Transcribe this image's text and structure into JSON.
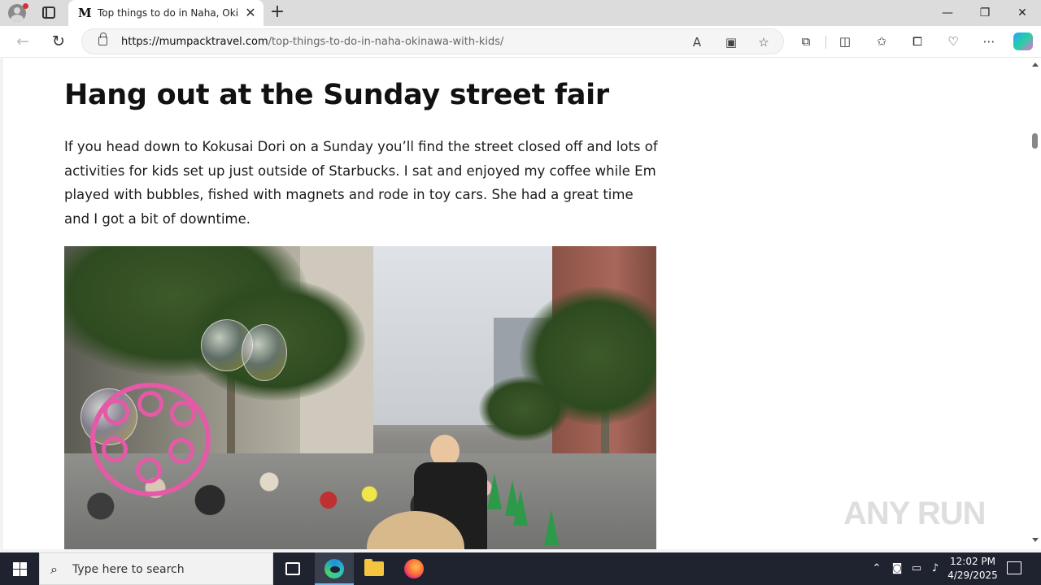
{
  "browser": {
    "tab": {
      "title": "Top things to do in Naha, Okinawa with Kids",
      "favicon_glyph": "M",
      "close_glyph": "✕"
    },
    "new_tab_glyph": "+",
    "window_controls": {
      "minimize": "—",
      "restore": "❐",
      "close": "✕"
    },
    "nav": {
      "back": "←",
      "refresh": "↻"
    },
    "address": {
      "host": "https://mumpacktravel.com",
      "path": "/top-things-to-do-in-naha-okinawa-with-kids/"
    },
    "icons": [
      "read-aloud-icon",
      "immersive-reader-icon",
      "favorite-star-icon",
      "extensions-icon",
      "split-screen-icon",
      "favorites-icon",
      "collections-icon",
      "browser-essentials-icon",
      "more-icon",
      "copilot-icon"
    ]
  },
  "article": {
    "heading": "Hang out at the Sunday street fair",
    "paragraph": "If you head down to Kokusai Dori on a Sunday you’ll find the street closed off and lots of activities for kids set up just outside of Starbucks. I sat and enjoyed my coffee while Em played with bubbles, fished with magnets and rode in toy cars. She had a great time and I got a bit of downtime."
  },
  "watermark": "ANY RUN",
  "taskbar": {
    "search_placeholder": "Type here to search",
    "time": "12:02 PM",
    "date": "4/29/2025",
    "tray_icons": [
      "chevron-up-icon",
      "meet-now-icon",
      "network-icon",
      "volume-icon"
    ],
    "apps": [
      "task-view-icon",
      "edge-icon",
      "file-explorer-icon",
      "firefox-icon"
    ]
  }
}
